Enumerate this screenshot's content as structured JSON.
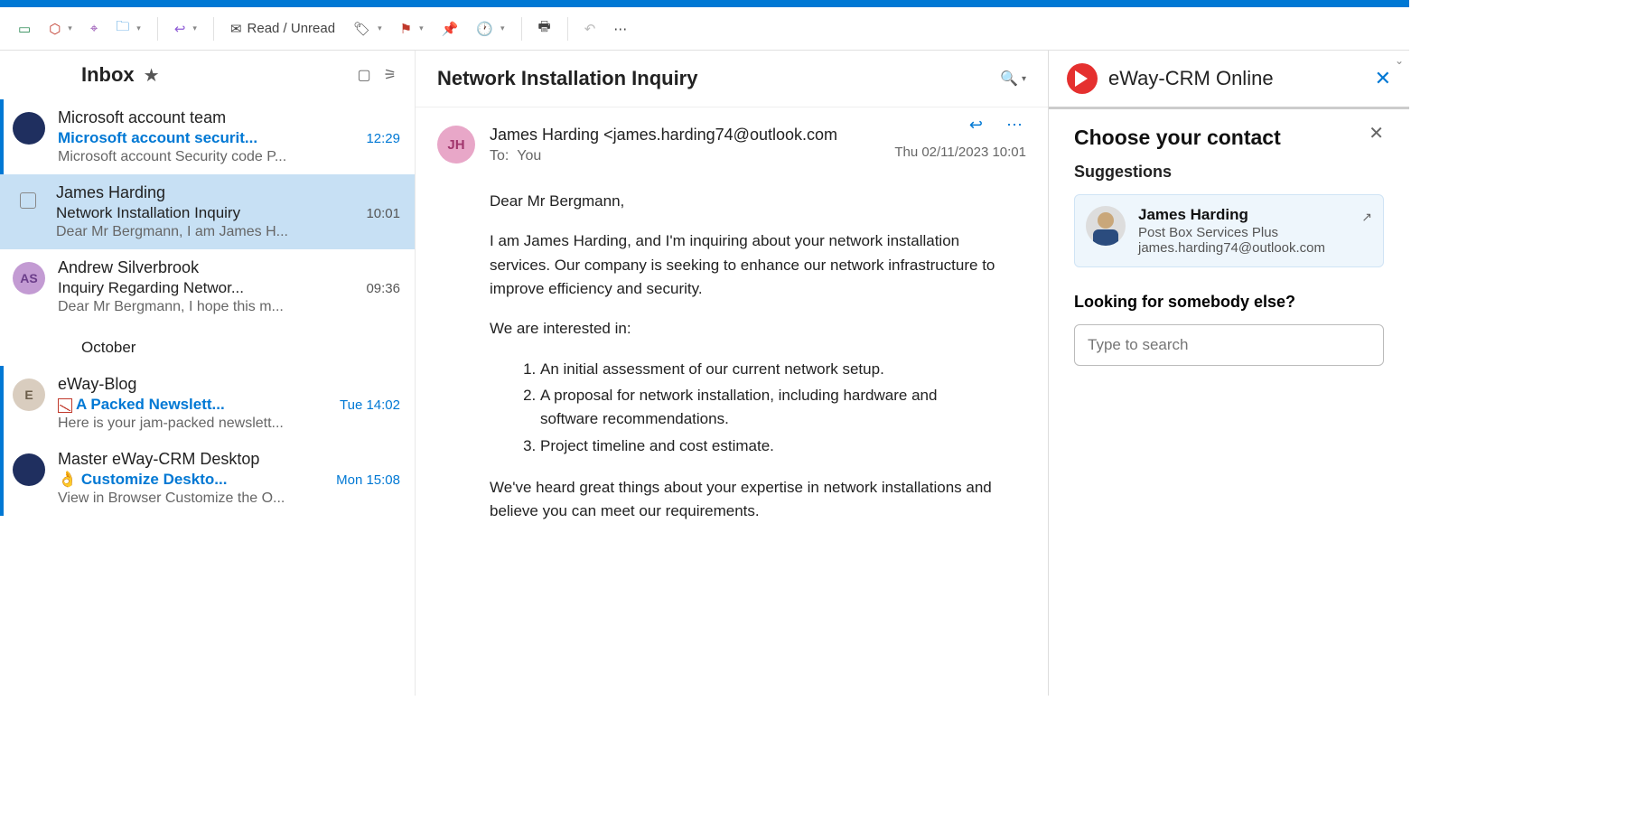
{
  "toolbar": {
    "read_unread": "Read / Unread"
  },
  "inbox": {
    "title": "Inbox",
    "items": [
      {
        "sender": "Microsoft account team",
        "subject": "Microsoft account securit...",
        "time": "12:29",
        "preview": "Microsoft account Security code P...",
        "unread": true,
        "avatar_class": "av-navy",
        "avatar_text": ""
      },
      {
        "sender": "James Harding",
        "subject": "Network Installation Inquiry",
        "time": "10:01",
        "preview": "Dear Mr Bergmann, I am James H...",
        "selected": true
      },
      {
        "sender": "Andrew Silverbrook",
        "subject": "Inquiry Regarding Networ...",
        "time": "09:36",
        "preview": "Dear Mr Bergmann, I hope this m...",
        "avatar_class": "av-purple",
        "avatar_text": "AS"
      }
    ],
    "separator": "October",
    "items_oct": [
      {
        "sender": "eWay-Blog",
        "subject": "A Packed Newslett...",
        "time": "Tue 14:02",
        "preview": "Here is your jam-packed newslett...",
        "unread": true,
        "avatar_class": "av-tan",
        "avatar_text": "E",
        "blue": true,
        "icon": "newsletter"
      },
      {
        "sender": "Master eWay-CRM Desktop",
        "subject": "Customize Deskto...",
        "time": "Mon 15:08",
        "preview": "View in Browser Customize the O...",
        "unread": true,
        "avatar_class": "av-navy",
        "avatar_text": "",
        "blue": true,
        "emoji": "👌"
      }
    ]
  },
  "reading": {
    "subject": "Network Installation Inquiry",
    "from_name": "James Harding",
    "from_email": "<james.harding74@outlook.com",
    "avatar_initials": "JH",
    "to_label": "To:",
    "to_value": "You",
    "datetime": "Thu 02/11/2023 10:01",
    "greeting": "Dear Mr Bergmann,",
    "para1": "I am James Harding, and I'm inquiring about your network installation services. Our company is seeking to enhance our network infrastructure to improve efficiency and security.",
    "interested": "We are interested in:",
    "li1": "An initial assessment of our current network setup.",
    "li2": "A proposal for network installation, including hardware and software recommendations.",
    "li3": "Project timeline and cost estimate.",
    "para2": "We've heard great things about your expertise in network installations and believe you can meet our requirements."
  },
  "crm": {
    "title": "eWay-CRM Online",
    "choose": "Choose your contact",
    "suggestions_label": "Suggestions",
    "suggestion": {
      "name": "James Harding",
      "company": "Post Box Services Plus",
      "email": "james.harding74@outlook.com"
    },
    "looking": "Looking for somebody else?",
    "search_placeholder": "Type to search"
  }
}
